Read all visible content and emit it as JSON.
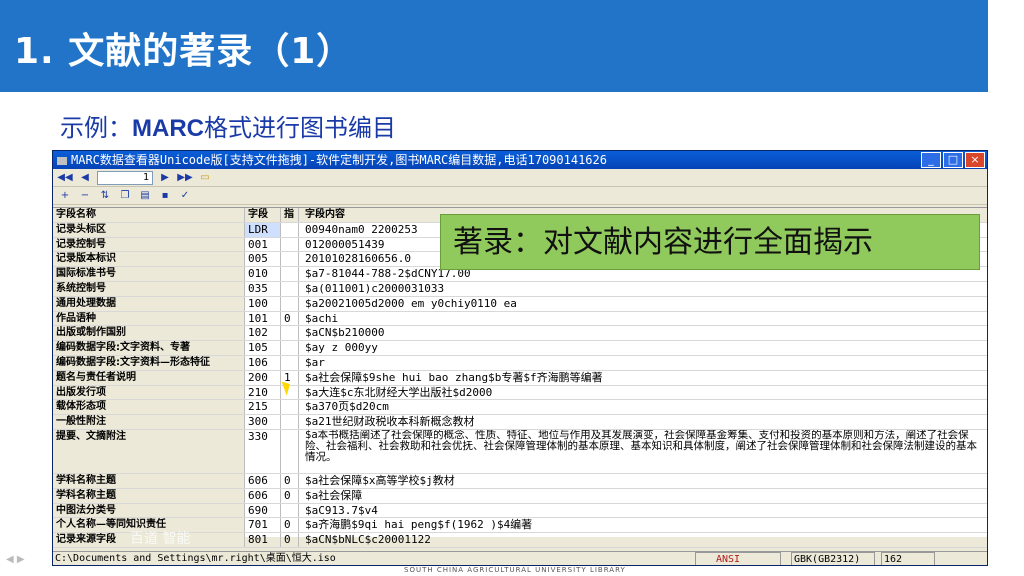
{
  "slide": {
    "title": "1. 文献的著录（1）",
    "subtitle_prefix": "示例：",
    "subtitle_bold": "MARC",
    "subtitle_suffix": "格式进行图书编目",
    "callout": "著录：对文献内容进行全面揭示",
    "footer_mark": "SOUTH CHINA AGRICULTURAL UNIVERSITY LIBRARY",
    "watermark": "百道 智能"
  },
  "app": {
    "window_title": "MARC数据查看器Unicode版[支持文件拖拽]-软件定制开发,图书MARC编目数据,电话17090141626",
    "window_buttons": [
      "_",
      "□",
      "×"
    ],
    "record_number": "1",
    "columns": {
      "name": "字段名称",
      "tag": "字段",
      "ind": "指",
      "content": "字段内容"
    },
    "rows": [
      {
        "name": "记录头标区",
        "tag": "LDR",
        "ind": "",
        "content": "00940nam0 2200253"
      },
      {
        "name": "记录控制号",
        "tag": "001",
        "ind": "",
        "content": "012000051439"
      },
      {
        "name": "记录版本标识",
        "tag": "005",
        "ind": "",
        "content": "20101028160656.0"
      },
      {
        "name": "国际标准书号",
        "tag": "010",
        "ind": "",
        "content": "$a7-81044-788-2$dCNY17.00"
      },
      {
        "name": "系统控制号",
        "tag": "035",
        "ind": "",
        "content": "$a(011001)c2000031033"
      },
      {
        "name": "通用处理数据",
        "tag": "100",
        "ind": "",
        "content": "$a20021005d2000    em y0chiy0110    ea"
      },
      {
        "name": "作品语种",
        "tag": "101",
        "ind": "0",
        "content": "$achi"
      },
      {
        "name": "出版或制作国别",
        "tag": "102",
        "ind": "",
        "content": "$aCN$b210000"
      },
      {
        "name": "编码数据字段:文字资料、专著",
        "tag": "105",
        "ind": "",
        "content": "$ay   z    000yy"
      },
      {
        "name": "编码数据字段:文字资料—形态特征",
        "tag": "106",
        "ind": "",
        "content": "$ar"
      },
      {
        "name": "题名与责任者说明",
        "tag": "200",
        "ind": "1",
        "content": "$a社会保障$9she hui bao zhang$b专著$f齐海鹏等编著"
      },
      {
        "name": "出版发行项",
        "tag": "210",
        "ind": "",
        "content": "$a大连$c东北财经大学出版社$d2000"
      },
      {
        "name": "载体形态项",
        "tag": "215",
        "ind": "",
        "content": "$a370页$d20cm"
      },
      {
        "name": "一般性附注",
        "tag": "300",
        "ind": "",
        "content": "$a21世纪财政税收本科新概念教材"
      },
      {
        "name": "提要、文摘附注",
        "tag": "330",
        "ind": "",
        "content": "$a本书概括阐述了社会保障的概念、性质、特征、地位与作用及其发展演变，社会保障基金筹集、支付和投资的基本原则和方法，阐述了社会保险、社会福利、社会救助和社会优抚、社会保障管理体制的基本原理、基本知识和具体制度，阐述了社会保障管理体制和社会保障法制建设的基本情况。"
      },
      {
        "name": "学科名称主题",
        "tag": "606",
        "ind": "0",
        "content": "$a社会保障$x高等学校$j教材"
      },
      {
        "name": "学科名称主题",
        "tag": "606",
        "ind": "0",
        "content": "$a社会保障"
      },
      {
        "name": "中图法分类号",
        "tag": "690",
        "ind": "",
        "content": "$aC913.7$v4"
      },
      {
        "name": "个人名称—等同知识责任",
        "tag": "701",
        "ind": "0",
        "content": "$a齐海鹏$9qi hai peng$f(1962 )$4编著"
      },
      {
        "name": "记录来源字段",
        "tag": "801",
        "ind": "0",
        "content": "$aCN$bNLC$c20001122"
      }
    ],
    "status": {
      "path": "C:\\Documents and Settings\\mr.right\\桌面\\恒大.iso",
      "encoding": "ANSI",
      "charset": "GBK(GB2312)",
      "count": "162"
    }
  },
  "colors": {
    "title_bar": "#2174c8",
    "callout_bg": "#90c95c",
    "subtitle": "#1a3aa8"
  }
}
